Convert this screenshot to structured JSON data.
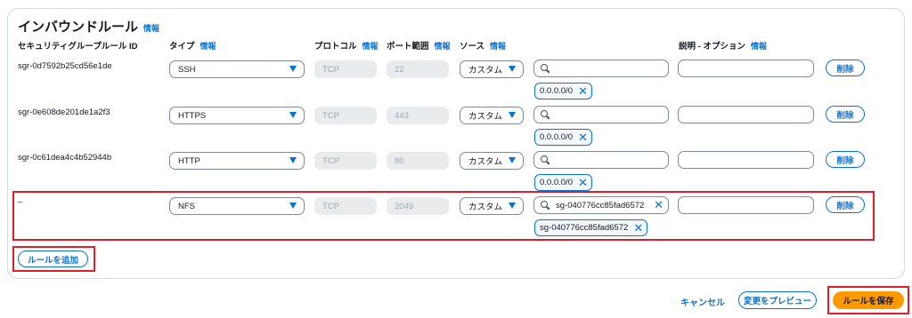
{
  "section": {
    "title": "インバウンドルール",
    "title_info": "情報"
  },
  "columns": {
    "rule_id": "セキュリティグループルール ID",
    "type": "タイプ",
    "type_info": "情報",
    "protocol": "プロトコル",
    "protocol_info": "情報",
    "port_range": "ポート範囲",
    "port_info": "情報",
    "source": "ソース",
    "source_info": "情報",
    "description": "説明 - オプション",
    "description_info": "情報"
  },
  "rules": [
    {
      "id": "sgr-0d7592b25cd56e1de",
      "type": "SSH",
      "protocol": "TCP",
      "port": "22",
      "source_type": "カスタム",
      "search_value": "",
      "token": "0.0.0.0/0",
      "delete_label": "削除"
    },
    {
      "id": "sgr-0e608de201de1a2f3",
      "type": "HTTPS",
      "protocol": "TCP",
      "port": "443",
      "source_type": "カスタム",
      "search_value": "",
      "token": "0.0.0.0/0",
      "delete_label": "削除"
    },
    {
      "id": "sgr-0c61dea4c4b52944b",
      "type": "HTTP",
      "protocol": "TCP",
      "port": "80",
      "source_type": "カスタム",
      "search_value": "",
      "token": "0.0.0.0/0",
      "delete_label": "削除"
    },
    {
      "id": "–",
      "type": "NFS",
      "protocol": "TCP",
      "port": "2049",
      "source_type": "カスタム",
      "search_value": "sg-040776cc85fad6572",
      "token": "sg-040776cc85fad6572",
      "delete_label": "削除"
    }
  ],
  "add_rule_label": "ルールを追加",
  "footer": {
    "cancel_label": "キャンセル",
    "preview_label": "変更をプレビュー",
    "save_label": "ルールを保存"
  },
  "colors": {
    "accent": "#0972d3",
    "primary_button": "#ff9900",
    "highlight": "#e11d2a"
  },
  "icons": {
    "dropdown": "caret-down-icon",
    "search": "search-icon",
    "remove": "close-icon"
  }
}
